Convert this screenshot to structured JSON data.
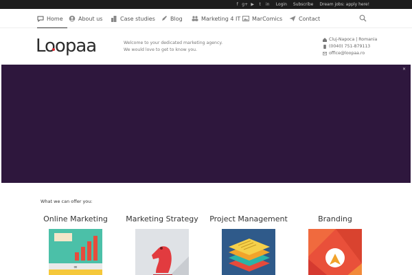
{
  "topbar": {
    "social_icons": [
      "facebook-icon",
      "google-plus-icon",
      "youtube-icon",
      "twitter-icon",
      "linkedin-icon"
    ],
    "login_label": "Login",
    "subscribe_label": "Subscribe",
    "jobs_label": "Dream jobs: apply here!"
  },
  "nav": {
    "items": [
      {
        "label": "Home",
        "icon": "chat-bubble-icon"
      },
      {
        "label": "About us",
        "icon": "user-circle-icon"
      },
      {
        "label": "Case studies",
        "icon": "buildings-icon"
      },
      {
        "label": "Blog",
        "icon": "edit-pen-icon"
      },
      {
        "label": "Marketing 4 IT",
        "icon": "users-icon"
      },
      {
        "label": "MarComics",
        "icon": "image-icon"
      },
      {
        "label": "Contact",
        "icon": "paper-plane-icon"
      }
    ],
    "active": "Home"
  },
  "header": {
    "logo": "Loopaa",
    "tagline_line1": "Welcome to your dedicated marketing agency.",
    "tagline_line2": "We would love to get to know you.",
    "location": "Cluj-Napoca | Romania",
    "phone": "(0040) 751-879113",
    "email": "office@loopaa.ro"
  },
  "colors": {
    "topbar_bg": "#1d1d1d",
    "hero_bg": "#2e173d",
    "brand_red": "#d9272e"
  },
  "services": {
    "heading": "What we can offer you:",
    "items": [
      {
        "title": "Online Marketing",
        "icon": "analytics-monitor-icon"
      },
      {
        "title": "Marketing Strategy",
        "icon": "chess-knight-icon"
      },
      {
        "title": "Project Management",
        "icon": "stacked-layers-icon"
      },
      {
        "title": "Branding",
        "icon": "brand-logo-icon"
      }
    ]
  }
}
